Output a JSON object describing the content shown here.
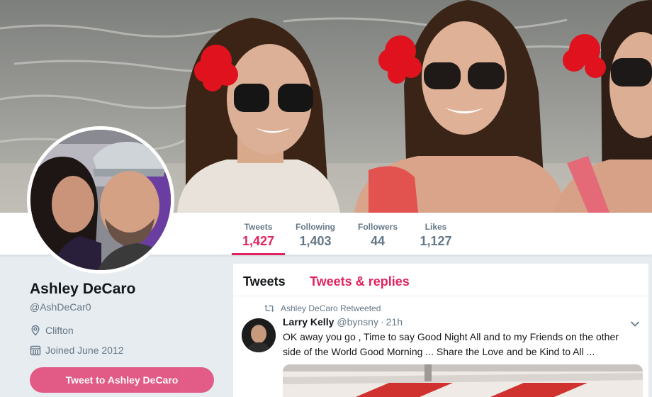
{
  "profile": {
    "name": "Ashley DeCaro",
    "handle": "@AshDeCar0",
    "location": "Clifton",
    "joined": "Joined June 2012",
    "tweet_to_label": "Tweet to Ashley DeCaro"
  },
  "stats": [
    {
      "label": "Tweets",
      "value": "1,427",
      "active": true
    },
    {
      "label": "Following",
      "value": "1,403",
      "active": false
    },
    {
      "label": "Followers",
      "value": "44",
      "active": false
    },
    {
      "label": "Likes",
      "value": "1,127",
      "active": false
    }
  ],
  "timeline": {
    "tabs": [
      {
        "label": "Tweets",
        "active": true
      },
      {
        "label": "Tweets & replies",
        "active": false
      }
    ]
  },
  "tweet": {
    "retweet_note": "Ashley DeCaro Retweeted",
    "author": "Larry Kelly",
    "handle": "@bynsny",
    "separator": "·",
    "time": "21h",
    "text": "OK away you go , Time to say Good Night All and to my Friends on the other side of the World Good Morning ... Share the Love and be Kind to All ..."
  },
  "icons": {
    "location": "location-pin-icon",
    "calendar": "calendar-icon",
    "retweet": "retweet-icon",
    "caret": "chevron-down-icon"
  },
  "colors": {
    "accent": "#e0245e",
    "secondary_text": "#657786",
    "primary_text": "#14171a",
    "background": "#e6ecf0"
  }
}
